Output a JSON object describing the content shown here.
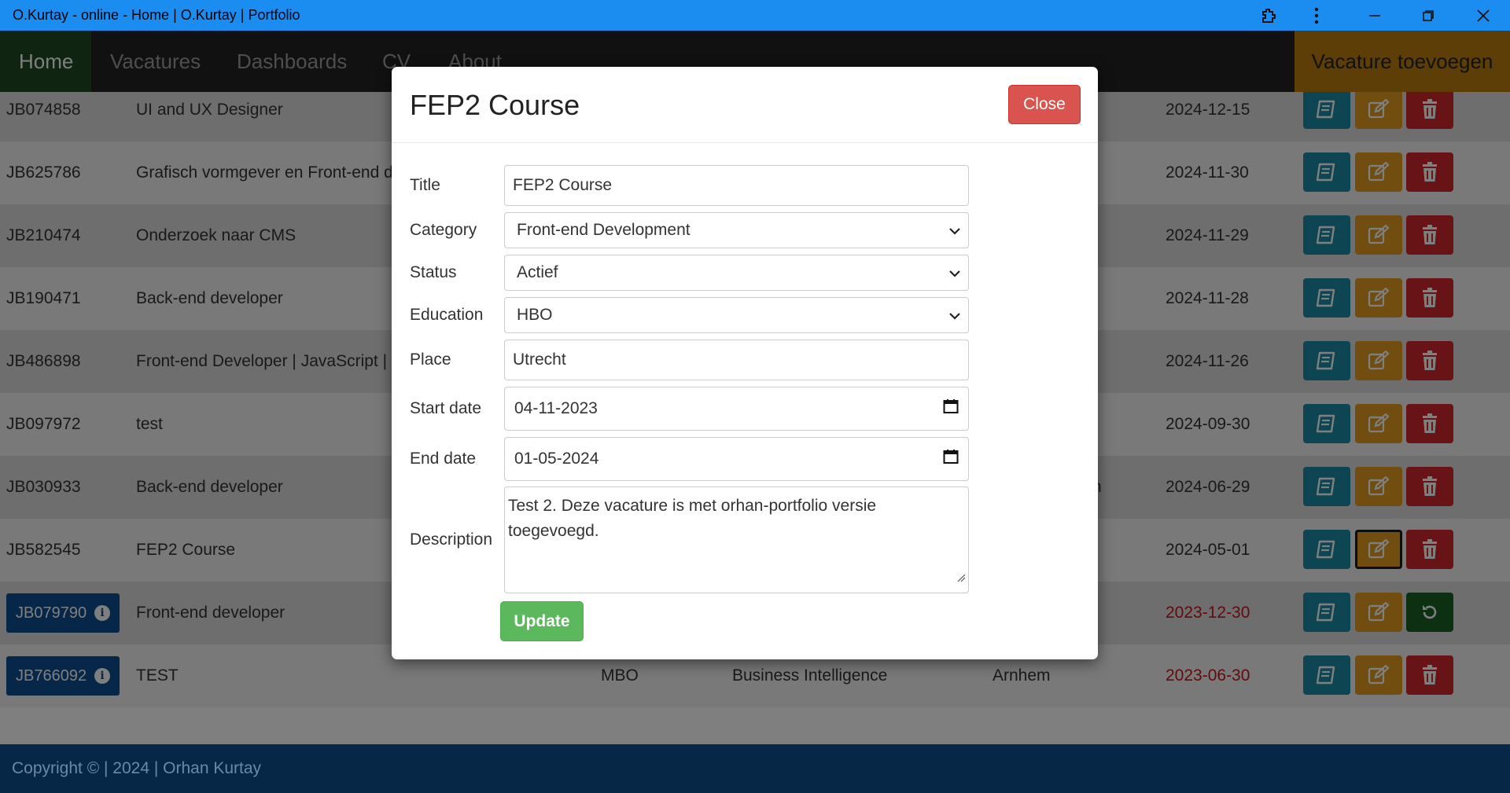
{
  "window": {
    "title": "O.Kurtay - online - Home | O.Kurtay | Portfolio",
    "controls": [
      "extension-icon",
      "more-icon",
      "minimize-icon",
      "restore-icon",
      "close-icon"
    ]
  },
  "nav": {
    "items": [
      {
        "label": "Home",
        "active": true
      },
      {
        "label": "Vacatures",
        "active": false
      },
      {
        "label": "Dashboards",
        "active": false
      },
      {
        "label": "CV",
        "active": false
      },
      {
        "label": "About",
        "active": false
      }
    ],
    "add_button": "Vacature toevoegen"
  },
  "table": {
    "rows": [
      {
        "id": "JB074858",
        "title": "UI and UX Designer",
        "education": "",
        "category": "",
        "place": "",
        "date": "2024-12-15",
        "badge": false,
        "expired": false,
        "third_action": "delete"
      },
      {
        "id": "JB625786",
        "title": "Grafisch vormgever en Front-end d",
        "education": "",
        "category": "",
        "place": "",
        "date": "2024-11-30",
        "badge": false,
        "expired": false,
        "third_action": "delete"
      },
      {
        "id": "JB210474",
        "title": "Onderzoek naar CMS",
        "education": "",
        "category": "",
        "place": "",
        "date": "2024-11-29",
        "badge": false,
        "expired": false,
        "third_action": "delete"
      },
      {
        "id": "JB190471",
        "title": "Back-end developer",
        "education": "",
        "category": "",
        "place": "",
        "date": "2024-11-28",
        "badge": false,
        "expired": false,
        "third_action": "delete"
      },
      {
        "id": "JB486898",
        "title": "Front-end Developer | JavaScript |",
        "education": "",
        "category": "",
        "place": "",
        "date": "2024-11-26",
        "badge": false,
        "expired": false,
        "third_action": "delete"
      },
      {
        "id": "JB097972",
        "title": "test",
        "education": "",
        "category": "",
        "place": "",
        "date": "2024-09-30",
        "badge": false,
        "expired": false,
        "third_action": "delete"
      },
      {
        "id": "JB030933",
        "title": "Back-end developer",
        "education": "",
        "category": "",
        "place": "n",
        "date": "2024-06-29",
        "badge": false,
        "expired": false,
        "third_action": "delete"
      },
      {
        "id": "JB582545",
        "title": "FEP2 Course",
        "education": "",
        "category": "",
        "place": "",
        "date": "2024-05-01",
        "badge": false,
        "expired": false,
        "third_action": "delete"
      },
      {
        "id": "JB079790",
        "title": "Front-end developer",
        "education": "",
        "category": "",
        "place": "",
        "date": "2023-12-30",
        "badge": true,
        "expired": true,
        "third_action": "restore"
      },
      {
        "id": "JB766092",
        "title": "TEST",
        "education": "MBO",
        "category": "Business Intelligence",
        "place": "Arnhem",
        "date": "2023-06-30",
        "badge": true,
        "expired": true,
        "third_action": "delete"
      }
    ]
  },
  "footer": {
    "text": "Copyright © | 2024 | Orhan Kurtay"
  },
  "modal": {
    "title": "FEP2 Course",
    "close_label": "Close",
    "fields": {
      "title": {
        "label": "Title",
        "value": "FEP2 Course"
      },
      "category": {
        "label": "Category",
        "value": "Front-end Development"
      },
      "status": {
        "label": "Status",
        "value": "Actief"
      },
      "education": {
        "label": "Education",
        "value": "HBO"
      },
      "place": {
        "label": "Place",
        "value": "Utrecht"
      },
      "start_date": {
        "label": "Start date",
        "value": "04-11-2023"
      },
      "end_date": {
        "label": "End date",
        "value": "01-05-2024"
      },
      "description": {
        "label": "Description",
        "value": "Test 2. Deze vacature is met orhan-portfolio versie toegevoegd."
      }
    },
    "update_label": "Update"
  },
  "colors": {
    "titlebar": "#1b8df0",
    "nav_bg": "#222222",
    "nav_active": "#1f4a23",
    "add_button": "#b97d0c",
    "view_button": "#1a8aa6",
    "edit_button": "#e39a21",
    "delete_button": "#d0272b",
    "restore_button": "#1a5e24",
    "close_button": "#d9534f",
    "update_button": "#5cb85c",
    "expired_date": "#c0191a",
    "footer": "#0d4f8a"
  }
}
